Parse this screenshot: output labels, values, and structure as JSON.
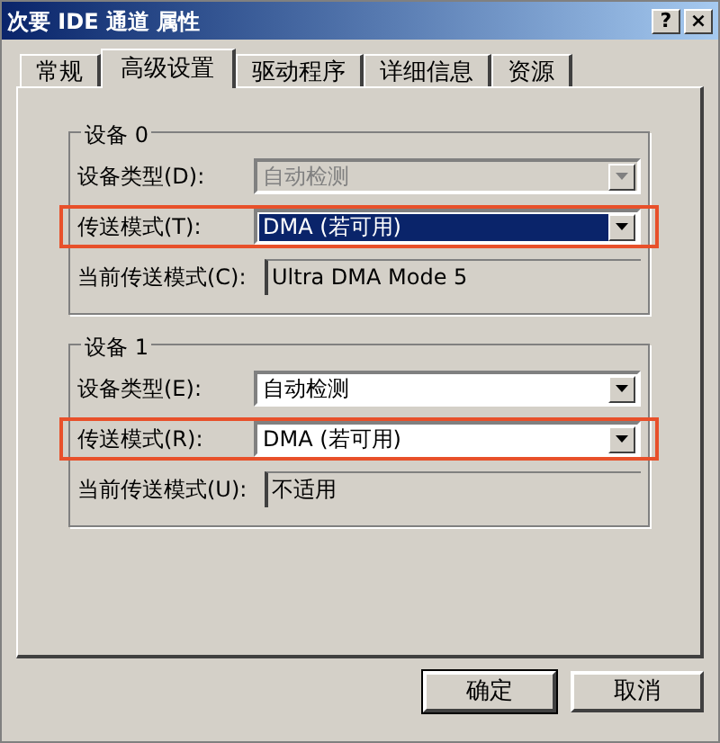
{
  "window": {
    "title": "次要 IDE 通道 属性",
    "controls": [
      "?",
      "×"
    ]
  },
  "tabs": [
    {
      "label": "常规",
      "selected": false
    },
    {
      "label": "高级设置",
      "selected": true
    },
    {
      "label": "驱动程序",
      "selected": false
    },
    {
      "label": "详细信息",
      "selected": false
    },
    {
      "label": "资源",
      "selected": false
    }
  ],
  "groups": [
    {
      "title": "设备 0",
      "fields": [
        {
          "kind": "dropdown",
          "label": "设备类型(D):",
          "value": "自动检测",
          "disabled": true,
          "focused": false,
          "highlighted": false
        },
        {
          "kind": "dropdown",
          "label": "传送模式(T):",
          "value": "DMA (若可用)",
          "disabled": false,
          "focused": true,
          "highlighted": true
        },
        {
          "kind": "readonly",
          "label": "当前传送模式(C):",
          "value": "Ultra DMA Mode 5",
          "highlighted": false
        }
      ]
    },
    {
      "title": "设备 1",
      "fields": [
        {
          "kind": "dropdown",
          "label": "设备类型(E):",
          "value": "自动检测",
          "disabled": false,
          "focused": false,
          "highlighted": false
        },
        {
          "kind": "dropdown",
          "label": "传送模式(R):",
          "value": "DMA (若可用)",
          "disabled": false,
          "focused": false,
          "highlighted": true
        },
        {
          "kind": "readonly",
          "label": "当前传送模式(U):",
          "value": "不适用",
          "highlighted": false
        }
      ]
    }
  ],
  "buttons": [
    "确定",
    "取消"
  ]
}
